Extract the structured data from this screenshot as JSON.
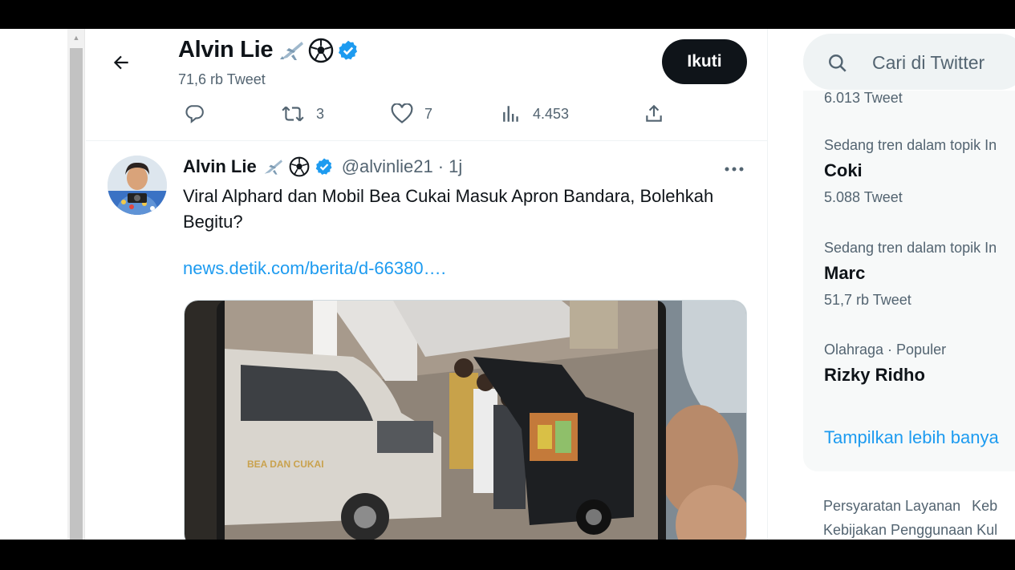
{
  "header": {
    "name": "Alvin Lie",
    "tweet_count": "71,6 rb Tweet",
    "follow_label": "Ikuti"
  },
  "actions": {
    "retweets": "3",
    "likes": "7",
    "views": "4.453"
  },
  "tweet": {
    "name": "Alvin Lie",
    "handle": "@alvinlie21",
    "separator": "·",
    "time": "1j",
    "text": "Viral Alphard dan Mobil Bea Cukai Masuk Apron Bandara, Bolehkah Begitu?",
    "link": "news.detik.com/berita/d-66380….",
    "van_label": "BEA DAN CUKAI"
  },
  "search": {
    "placeholder": "Cari di Twitter"
  },
  "trends": {
    "partial_count": "6.013 Tweet",
    "items": [
      {
        "meta": "Sedang tren dalam topik In",
        "name": "Coki",
        "count": "5.088 Tweet"
      },
      {
        "meta": "Sedang tren dalam topik In",
        "name": "Marc",
        "count": "51,7 rb Tweet"
      },
      {
        "meta": "Olahraga · Populer",
        "name": "Rizky Ridho",
        "count": ""
      }
    ],
    "show_more": "Tampilkan lebih banya"
  },
  "footer": {
    "links": [
      "Persyaratan Layanan",
      "Keb",
      "Kebijakan Penggunaan Kul"
    ]
  },
  "colors": {
    "accent": "#1d9bf0",
    "text": "#0f1419",
    "muted": "#536471",
    "verified": "#1d9bf0"
  }
}
